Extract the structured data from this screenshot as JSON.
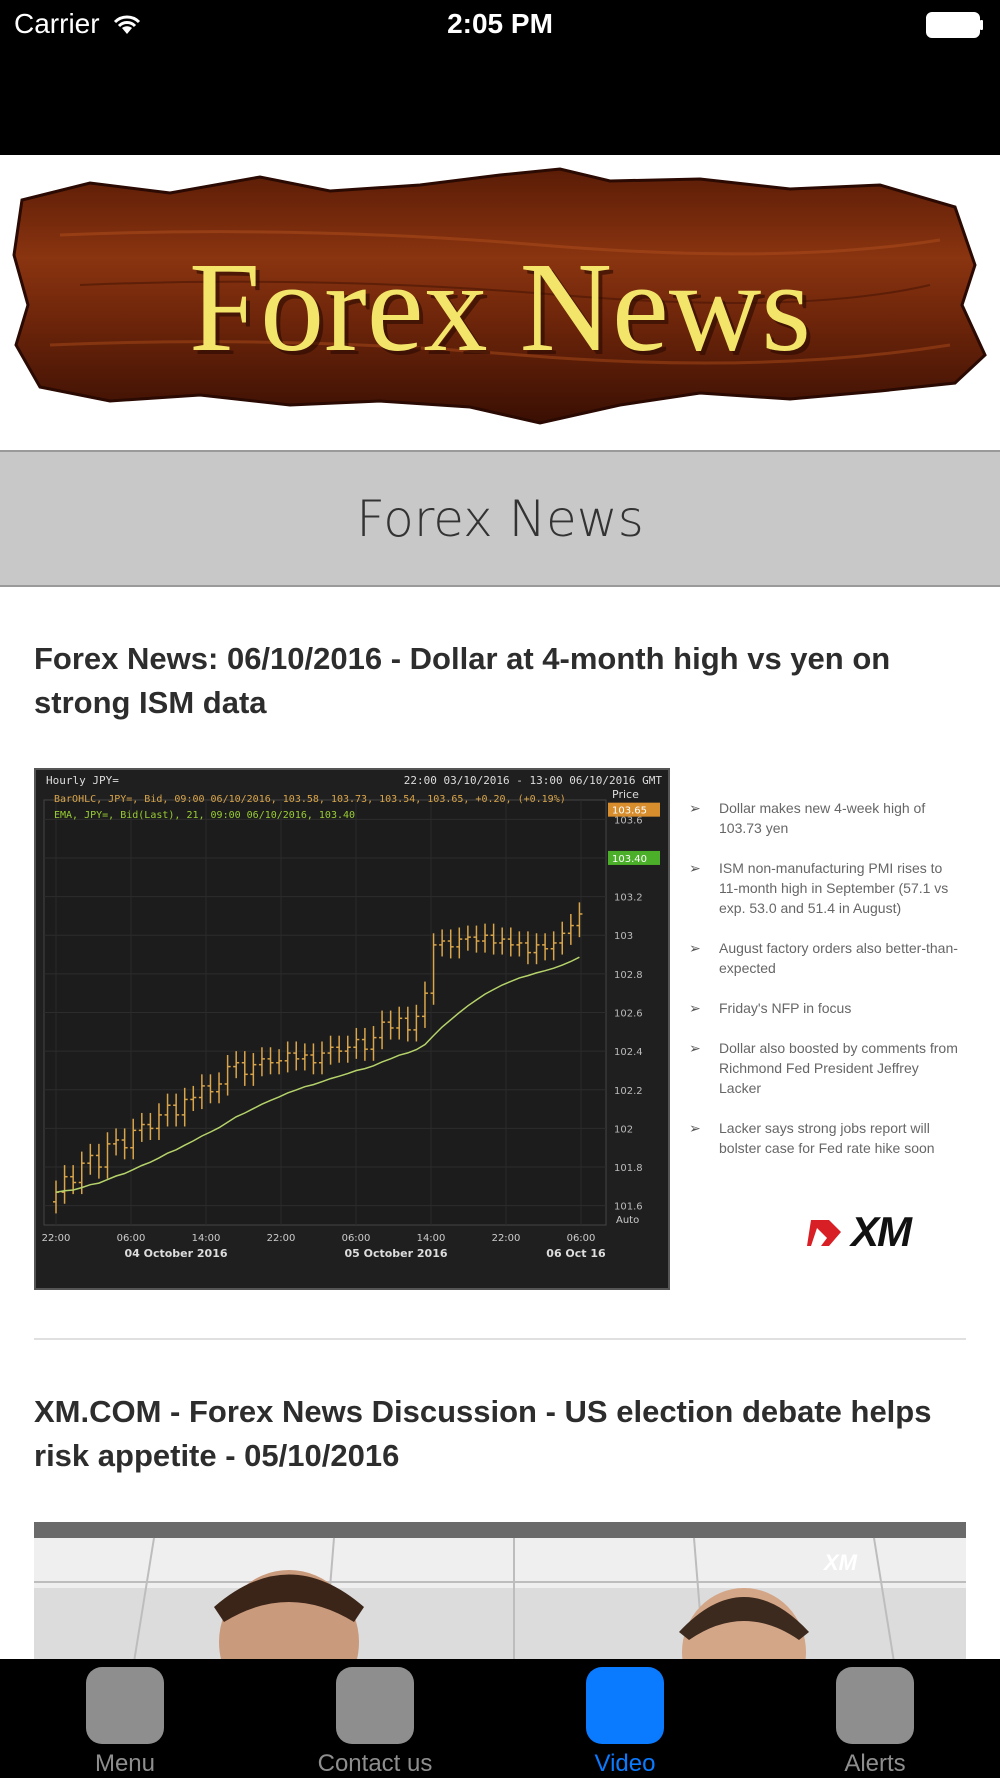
{
  "status_bar": {
    "carrier": "Carrier",
    "time": "2:05 PM",
    "icons": [
      "wifi-icon",
      "battery-icon"
    ]
  },
  "banner": {
    "logo_text": "Forex News"
  },
  "section": {
    "title": "Forex News"
  },
  "articles": [
    {
      "title": "Forex News: 06/10/2016 - Dollar at 4-month high vs yen on strong ISM data",
      "thumbnail": {
        "chart_header_left": "Hourly JPY=",
        "chart_header_right": "22:00 03/10/2016 - 13:00 06/10/2016 GMT",
        "legend_1": "BarOHLC, JPY=, Bid, 09:00 06/10/2016, 103.58, 103.73, 103.54, 103.65, +0.20, (+0.19%)",
        "legend_2": "EMA, JPY=, Bid(Last), 21, 09:00 06/10/2016, 103.40",
        "price_label": "Price",
        "price_current": "103.65",
        "price_ema": "103.40",
        "y_ticks": [
          "103.6",
          "103.4",
          "103.2",
          "103",
          "102.8",
          "102.6",
          "102.4",
          "102.2",
          "102",
          "101.8",
          "101.6"
        ],
        "x_ticks": [
          "22:00",
          "06:00",
          "14:00",
          "22:00",
          "06:00",
          "14:00",
          "22:00",
          "06:00"
        ],
        "date_labels": [
          "04 October 2016",
          "05 October 2016",
          "06 Oct 16"
        ],
        "auto_label": "Auto",
        "bullets": [
          "Dollar makes new 4-week high of 103.73 yen",
          "ISM non-manufacturing PMI rises to 11-month high in September (57.1 vs exp. 53.0 and 51.4 in August)",
          "August factory orders also better-than-expected",
          "Friday's NFP in focus",
          "Dollar also boosted by comments from Richmond Fed President Jeffrey Lacker",
          "Lacker says strong jobs report will bolster case for Fed rate hike soon"
        ],
        "brand": "XM"
      }
    },
    {
      "title": "XM.COM - Forex News Discussion - US election debate helps risk appetite - 05/10/2016",
      "thumbnail": {
        "brand": "XM"
      }
    }
  ],
  "tabs": [
    {
      "label": "Menu",
      "active": false
    },
    {
      "label": "Contact us",
      "active": false
    },
    {
      "label": "Video",
      "active": true
    },
    {
      "label": "Alerts",
      "active": false
    }
  ],
  "colors": {
    "active_tab": "#0a7aff",
    "inactive_tab": "#8e8e8e",
    "banner_text": "#f3e46a",
    "section_bg": "#c8c8c8"
  }
}
